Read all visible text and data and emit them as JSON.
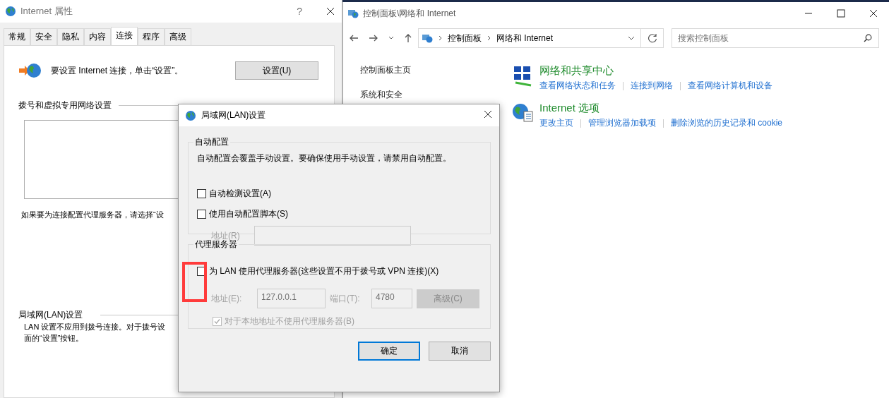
{
  "internet_properties": {
    "title": "Internet 属性",
    "help": "?",
    "tabs": [
      {
        "label": "常规",
        "selected": false
      },
      {
        "label": "安全",
        "selected": false
      },
      {
        "label": "隐私",
        "selected": false
      },
      {
        "label": "内容",
        "selected": false
      },
      {
        "label": "连接",
        "selected": true
      },
      {
        "label": "程序",
        "selected": false
      },
      {
        "label": "高级",
        "selected": false
      }
    ],
    "setup_text": "要设置 Internet 连接，单击“设置”。",
    "setup_button": "设置(U)",
    "dialup_heading": "拨号和虚拟专用网络设置",
    "proxy_hint": "如果要为连接配置代理服务器，请选择“设",
    "lan_heading": "局域网(LAN)设置",
    "lan_text_lines": [
      "LAN 设置不应用到拨号连接。对于拨号设",
      "面的“设置”按钮。"
    ]
  },
  "control_panel": {
    "title": "控制面板\\网络和 Internet",
    "breadcrumb": [
      "控制面板",
      "网络和 Internet"
    ],
    "search": {
      "placeholder": "搜索控制面板"
    },
    "sidebar": {
      "items": [
        "控制面板主页",
        "系统和安全"
      ]
    },
    "categories": [
      {
        "kind": "network",
        "title": "网络和共享中心",
        "links": [
          "查看网络状态和任务",
          "连接到网络",
          "查看网络计算机和设备"
        ]
      },
      {
        "kind": "internet",
        "title": "Internet 选项",
        "links": [
          "更改主页",
          "管理浏览器加载项",
          "删除浏览的历史记录和 cookie"
        ]
      }
    ]
  },
  "lan_dialog": {
    "title": "局域网(LAN)设置",
    "auto_group": {
      "label": "自动配置",
      "note": "自动配置会覆盖手动设置。要确保使用手动设置，请禁用自动配置。",
      "options": [
        {
          "label": "自动检测设置(A)",
          "checked": false
        },
        {
          "label": "使用自动配置脚本(S)",
          "checked": false
        }
      ],
      "address_label": "地址(R)",
      "disabled": true
    },
    "proxy_group": {
      "label": "代理服务器",
      "use_proxy": {
        "label": "为 LAN 使用代理服务器(这些设置不用于拨号或 VPN 连接)(X)",
        "checked": false
      },
      "address_label": "地址(E):",
      "address": "127.0.0.1",
      "port_label": "端口(T):",
      "port": "4780",
      "advanced_button": "高级(C)",
      "disabled": true,
      "bypass_local": {
        "label": "对于本地地址不使用代理服务器(B)",
        "checked": true
      }
    },
    "buttons": [
      {
        "label": "确定",
        "default": true
      },
      {
        "label": "取消",
        "default": false
      }
    ]
  },
  "annotation": {
    "kind": "highlight"
  }
}
